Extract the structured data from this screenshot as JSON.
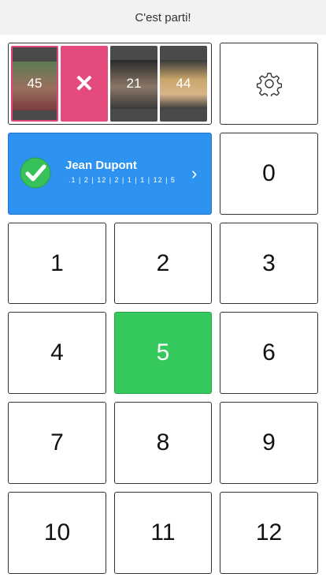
{
  "header": {
    "title": "C'est parti!"
  },
  "players": [
    {
      "number": "45",
      "selected": true
    },
    {
      "number": "✕",
      "remove": true
    },
    {
      "number": "21"
    },
    {
      "number": "44"
    }
  ],
  "current_player": {
    "name": "Jean Dupont",
    "scores": ".1 | 2 | 12 | 2 | 1 | 1 | 12 | 5"
  },
  "keypad": [
    "0",
    "1",
    "2",
    "3",
    "4",
    "5",
    "6",
    "7",
    "8",
    "9",
    "10",
    "11",
    "12"
  ],
  "selected_key": "5",
  "colors": {
    "accent_blue": "#2e93f0",
    "accent_green": "#35c85c",
    "accent_pink": "#e44b7c"
  }
}
